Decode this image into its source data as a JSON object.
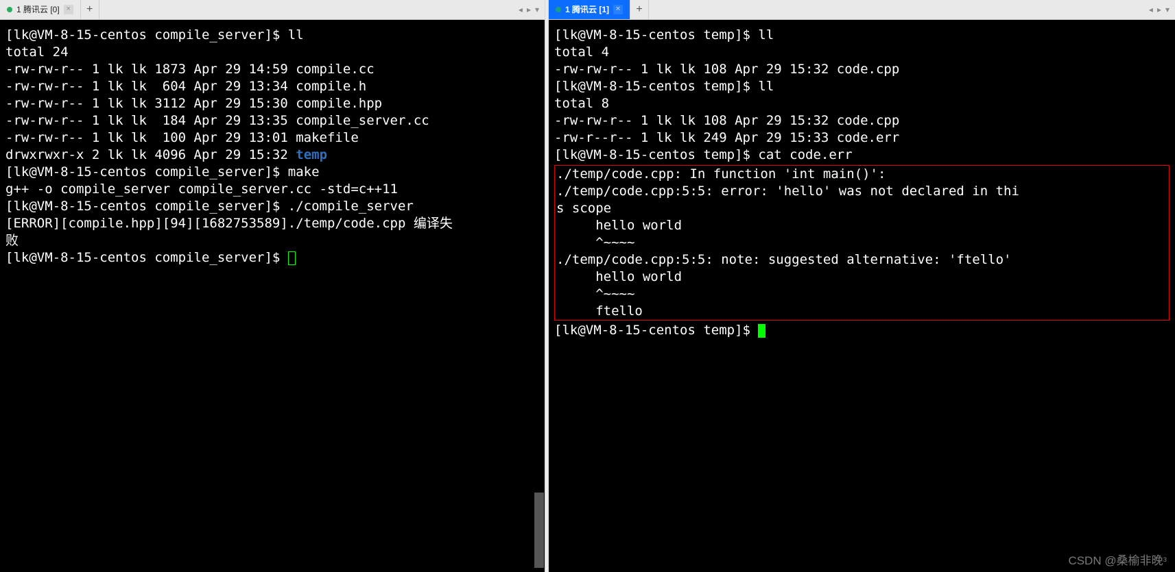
{
  "left": {
    "tab": {
      "title": "1 腾讯云 [0]",
      "status": "green"
    },
    "lines": [
      {
        "segs": [
          {
            "t": "[lk@VM-8-15-centos compile_server]$ ll"
          }
        ]
      },
      {
        "segs": [
          {
            "t": "total 24"
          }
        ]
      },
      {
        "segs": [
          {
            "t": "-rw-rw-r-- 1 lk lk 1873 Apr 29 14:59 compile.cc"
          }
        ]
      },
      {
        "segs": [
          {
            "t": "-rw-rw-r-- 1 lk lk  604 Apr 29 13:34 compile.h"
          }
        ]
      },
      {
        "segs": [
          {
            "t": "-rw-rw-r-- 1 lk lk 3112 Apr 29 15:30 compile.hpp"
          }
        ]
      },
      {
        "segs": [
          {
            "t": "-rw-rw-r-- 1 lk lk  184 Apr 29 13:35 compile_server.cc"
          }
        ]
      },
      {
        "segs": [
          {
            "t": "-rw-rw-r-- 1 lk lk  100 Apr 29 13:01 makefile"
          }
        ]
      },
      {
        "segs": [
          {
            "t": "drwxrwxr-x 2 lk lk 4096 Apr 29 15:32 "
          },
          {
            "t": "temp",
            "cls": "dir"
          }
        ]
      },
      {
        "segs": [
          {
            "t": "[lk@VM-8-15-centos compile_server]$ make"
          }
        ]
      },
      {
        "segs": [
          {
            "t": "g++ -o compile_server compile_server.cc -std=c++11"
          }
        ]
      },
      {
        "segs": [
          {
            "t": "[lk@VM-8-15-centos compile_server]$ ./compile_server"
          }
        ]
      },
      {
        "segs": [
          {
            "t": "[ERROR][compile.hpp][94][1682753589]./temp/code.cpp 编译失"
          }
        ]
      },
      {
        "segs": [
          {
            "t": "败"
          }
        ]
      },
      {
        "segs": [
          {
            "t": "[lk@VM-8-15-centos compile_server]$ "
          },
          {
            "t": "",
            "cursor": "outline"
          }
        ]
      }
    ]
  },
  "right": {
    "tab": {
      "title": "1 腾讯云 [1]",
      "status": "teal"
    },
    "lines_top": [
      {
        "segs": [
          {
            "t": "[lk@VM-8-15-centos temp]$ ll"
          }
        ]
      },
      {
        "segs": [
          {
            "t": "total 4"
          }
        ]
      },
      {
        "segs": [
          {
            "t": "-rw-rw-r-- 1 lk lk 108 Apr 29 15:32 code.cpp"
          }
        ]
      },
      {
        "segs": [
          {
            "t": "[lk@VM-8-15-centos temp]$ ll"
          }
        ]
      },
      {
        "segs": [
          {
            "t": "total 8"
          }
        ]
      },
      {
        "segs": [
          {
            "t": "-rw-rw-r-- 1 lk lk 108 Apr 29 15:32 code.cpp"
          }
        ]
      },
      {
        "segs": [
          {
            "t": "-rw-r--r-- 1 lk lk 249 Apr 29 15:33 code.err"
          }
        ]
      },
      {
        "segs": [
          {
            "t": "[lk@VM-8-15-centos temp]$ cat code.err"
          }
        ]
      }
    ],
    "lines_box": [
      {
        "segs": [
          {
            "t": "./temp/code.cpp: In function 'int main()':"
          }
        ]
      },
      {
        "segs": [
          {
            "t": "./temp/code.cpp:5:5: error: 'hello' was not declared in thi"
          }
        ]
      },
      {
        "segs": [
          {
            "t": "s scope"
          }
        ]
      },
      {
        "segs": [
          {
            "t": "     hello world"
          }
        ]
      },
      {
        "segs": [
          {
            "t": "     ^~~~~"
          }
        ]
      },
      {
        "segs": [
          {
            "t": "./temp/code.cpp:5:5: note: suggested alternative: 'ftello'"
          }
        ]
      },
      {
        "segs": [
          {
            "t": "     hello world"
          }
        ]
      },
      {
        "segs": [
          {
            "t": "     ^~~~~"
          }
        ]
      },
      {
        "segs": [
          {
            "t": "     ftello"
          }
        ]
      }
    ],
    "lines_bottom": [
      {
        "segs": [
          {
            "t": "[lk@VM-8-15-centos temp]$ "
          },
          {
            "t": "",
            "cursor": "block"
          }
        ]
      }
    ]
  },
  "watermark": "CSDN @桑榆非晚ᵌ"
}
